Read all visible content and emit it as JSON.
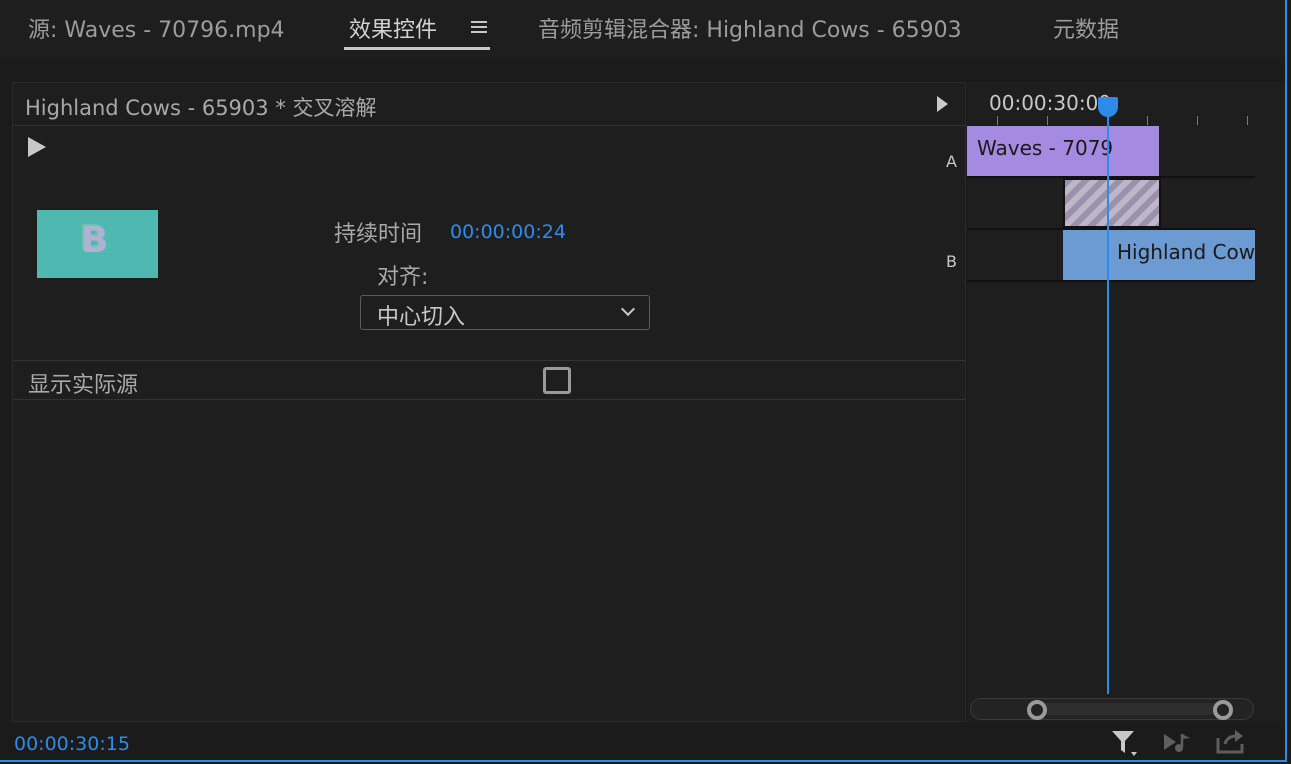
{
  "tabs": [
    {
      "label": "源: Waves - 70796.mp4",
      "active": false
    },
    {
      "label": "效果控件",
      "active": true
    },
    {
      "label": "音频剪辑混合器: Highland Cows - 65903",
      "active": false
    },
    {
      "label": "元数据",
      "active": false
    }
  ],
  "effect_controls": {
    "clip_title": "Highland Cows - 65903 * 交叉溶解",
    "preview_letter": "B",
    "duration_label": "持续时间",
    "duration_value": "00:00:00:24",
    "alignment_label": "对齐:",
    "alignment_value": "中心切入",
    "show_actual_sources_label": "显示实际源",
    "show_actual_sources_checked": false,
    "current_time": "00:00:30:15"
  },
  "timeline": {
    "timecode": "00:00:30:00",
    "track_a_label": "A",
    "track_b_label": "B",
    "clip_a_label": "Waves - 7079",
    "clip_b_label": "Highland Cow"
  },
  "icons": {
    "menu": "hamburger-menu-icon",
    "play": "play-icon",
    "fx": "fx-icon",
    "filter": "filter-icon",
    "audio": "play-audio-icon",
    "export": "export-icon"
  },
  "colors": {
    "accent": "#2d8ceb",
    "clip_a": "#a48ae0",
    "clip_b": "#6c9ad2",
    "preview": "#4fb8b0"
  }
}
